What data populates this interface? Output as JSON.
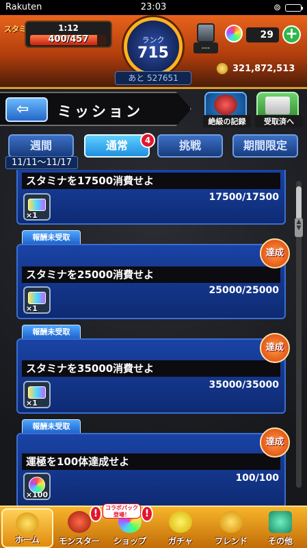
{
  "status_bar": {
    "carrier": "Rakuten",
    "time": "23:03"
  },
  "header": {
    "stamina_label": "スタミナ",
    "stamina_timer": "1:12",
    "stamina": "400/457",
    "stamina_fill": 0.875,
    "rank_label": "ランク",
    "rank": "715",
    "next_rank": "あと 527651",
    "box_count": "---",
    "orb_count": "29",
    "plus": "+",
    "gold": "321,872,513"
  },
  "title_row": {
    "back_arrow": "⇦",
    "title": "ミッション",
    "zetsu_label": "絶級の記録",
    "received_label": "受取済へ"
  },
  "tabs": [
    {
      "label": "週間"
    },
    {
      "label": "通常"
    },
    {
      "label": "挑戦"
    },
    {
      "label": "期間限定"
    }
  ],
  "tab_badge": "4",
  "date_range": "11/11〜11/17",
  "missions": [
    {
      "title": "スタミナを17500消費せよ",
      "progress": "17500/17500",
      "reward_qty": "×1"
    },
    {
      "label": "報酬未受取",
      "title": "スタミナを25000消費せよ",
      "progress": "25000/25000",
      "reward_qty": "×1",
      "stamp": "達成"
    },
    {
      "label": "報酬未受取",
      "title": "スタミナを35000消費せよ",
      "progress": "35000/35000",
      "reward_qty": "×1",
      "stamp": "達成"
    },
    {
      "label": "報酬未受取",
      "title": "運極を100体達成せよ",
      "progress": "100/100",
      "reward_qty": "×100",
      "stamp": "達成"
    }
  ],
  "bottom_nav": [
    {
      "label": "ホーム"
    },
    {
      "label": "モンスター"
    },
    {
      "label": "ショップ"
    },
    {
      "label": "ガチャ"
    },
    {
      "label": "フレンド"
    },
    {
      "label": "その他"
    }
  ],
  "collab_badge": "コラボパック登場！",
  "alert_mark": "!"
}
